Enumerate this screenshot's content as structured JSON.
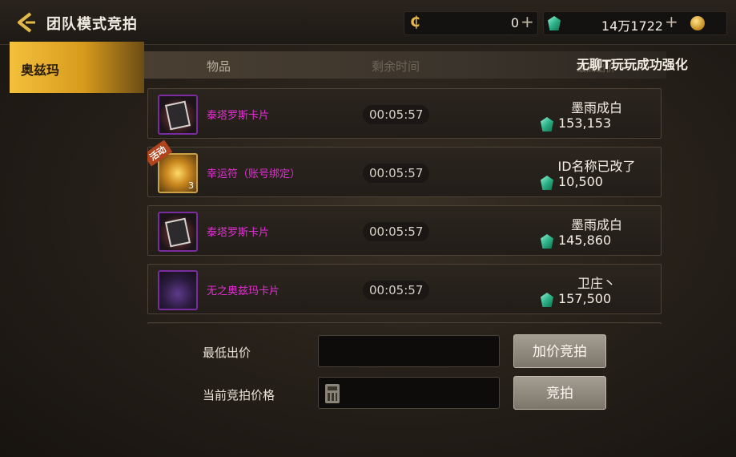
{
  "header": {
    "title": "团队模式竞拍",
    "currency_c_value": "0",
    "currency_gem_value": "14万1722"
  },
  "side_tabs": [
    {
      "label": "奥兹玛",
      "selected": true
    }
  ],
  "columns": {
    "item": "物品",
    "time_left": "剩余时间",
    "bid": "最高出价"
  },
  "marquee": "无聊T玩玩成功强化",
  "rows": [
    {
      "name": "泰塔罗斯卡片",
      "timer": "00:05:57",
      "bidder": "墨雨成白",
      "price": "153,153",
      "icon": "card-icon"
    },
    {
      "name": "幸运符（账号绑定）",
      "timer": "00:05:57",
      "bidder": "ID名称已改了",
      "price": "10,500",
      "icon": "lucky-charm-icon",
      "badge": "活动",
      "qty": "3"
    },
    {
      "name": "泰塔罗斯卡片",
      "timer": "00:05:57",
      "bidder": "墨雨成白",
      "price": "145,860",
      "icon": "card-icon"
    },
    {
      "name": "无之奥兹玛卡片",
      "timer": "00:05:57",
      "bidder": "卫庄丶",
      "price": "157,500",
      "icon": "ozma-card-icon"
    }
  ],
  "bottom": {
    "min_bid_label": "最低出价",
    "current_bid_label": "当前竞拍价格",
    "raise_button": "加价竞拍",
    "bid_button": "竞拍"
  },
  "colors": {
    "item_name": "#e22fd3",
    "tab_gold": "#f3c13c"
  }
}
